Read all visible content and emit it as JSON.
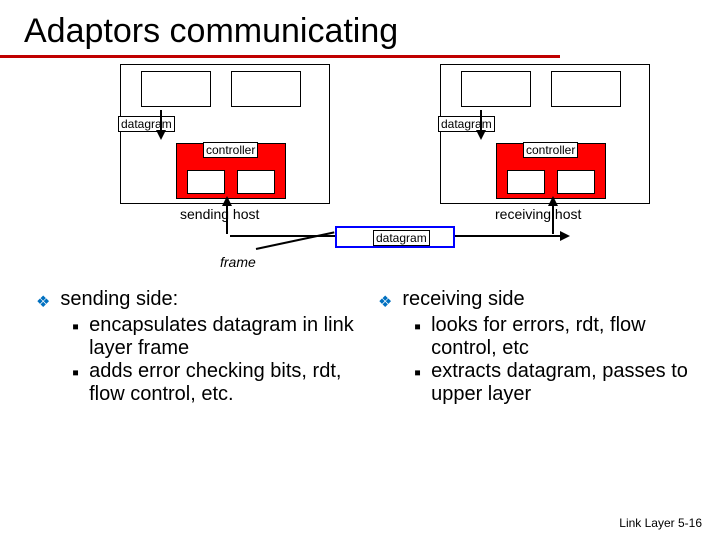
{
  "title": "Adaptors communicating",
  "diagram": {
    "datagram_label": "datagram",
    "controller_label": "controller",
    "sending_host": "sending host",
    "receiving_host": "receiving host",
    "frame_datagram": "datagram",
    "frame_label": "frame"
  },
  "left": {
    "heading": "sending side:",
    "items": [
      "encapsulates datagram in link layer frame",
      "adds error checking bits, rdt, flow control, etc."
    ]
  },
  "right": {
    "heading": "receiving side",
    "items": [
      "looks for errors, rdt, flow control, etc",
      "extracts datagram, passes to upper layer"
    ]
  },
  "footer": "Link Layer  5-16"
}
